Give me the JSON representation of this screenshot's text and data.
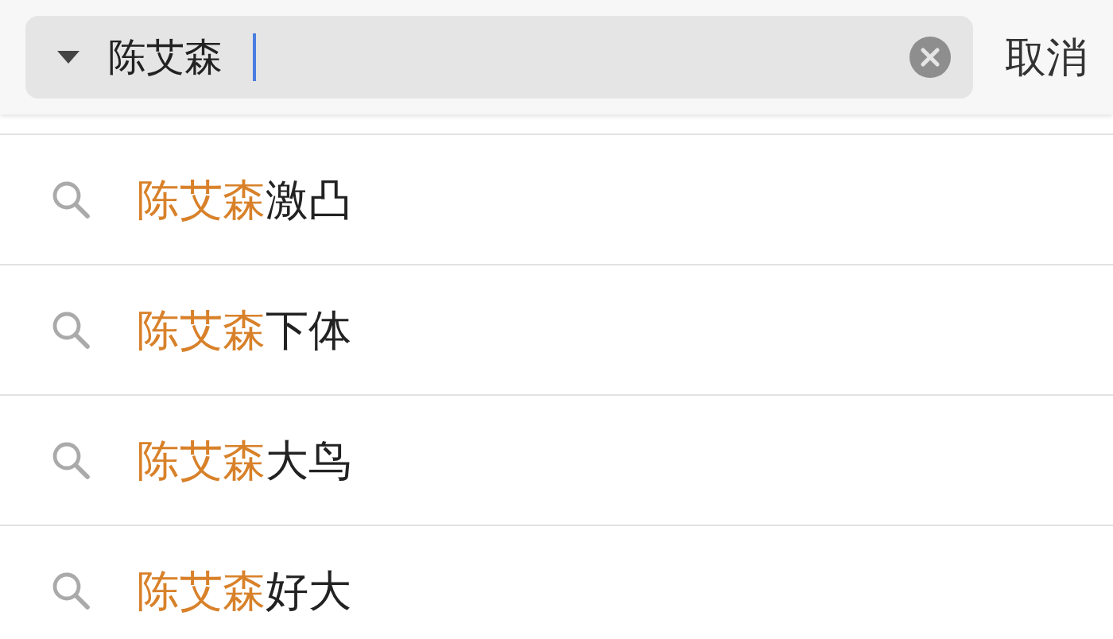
{
  "search": {
    "value": "陈艾森"
  },
  "cancel": "取消",
  "suggestions": [
    {
      "match": "陈艾森",
      "completion": "激凸"
    },
    {
      "match": "陈艾森",
      "completion": "下体"
    },
    {
      "match": "陈艾森",
      "completion": "大鸟"
    },
    {
      "match": "陈艾森",
      "completion": "好大"
    }
  ]
}
